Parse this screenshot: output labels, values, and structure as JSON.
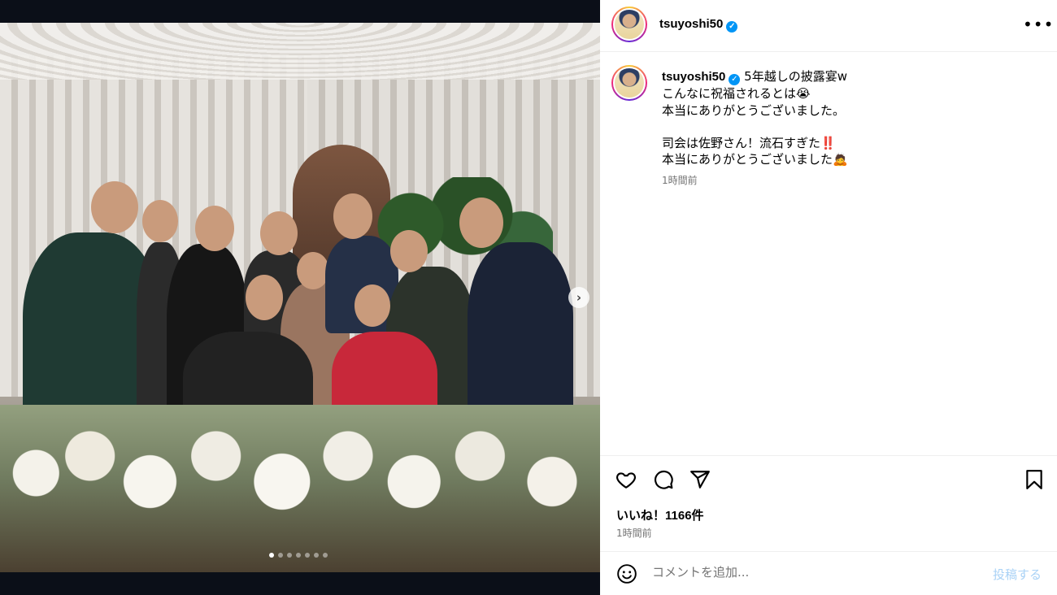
{
  "post": {
    "username": "tsuyoshi50",
    "verified_icon": "verified-badge-icon",
    "caption_title": "5年越しの披露宴w",
    "caption_body": "こんなに祝福されるとは😭\n本当にありがとうございました。\n\n司会は佐野さん！流石すぎた‼️\n本当にありがとうございました🙇",
    "caption_time": "1時間前",
    "likes": "いいね！1166件",
    "time": "1時間前"
  },
  "comment": {
    "placeholder": "コメントを追加...",
    "post_label": "投稿する"
  },
  "carousel": {
    "slides": 7,
    "active": 1
  },
  "colors": {
    "accent": "#0095f6",
    "muted": "#737373",
    "post_disabled": "#a9d2f6"
  }
}
